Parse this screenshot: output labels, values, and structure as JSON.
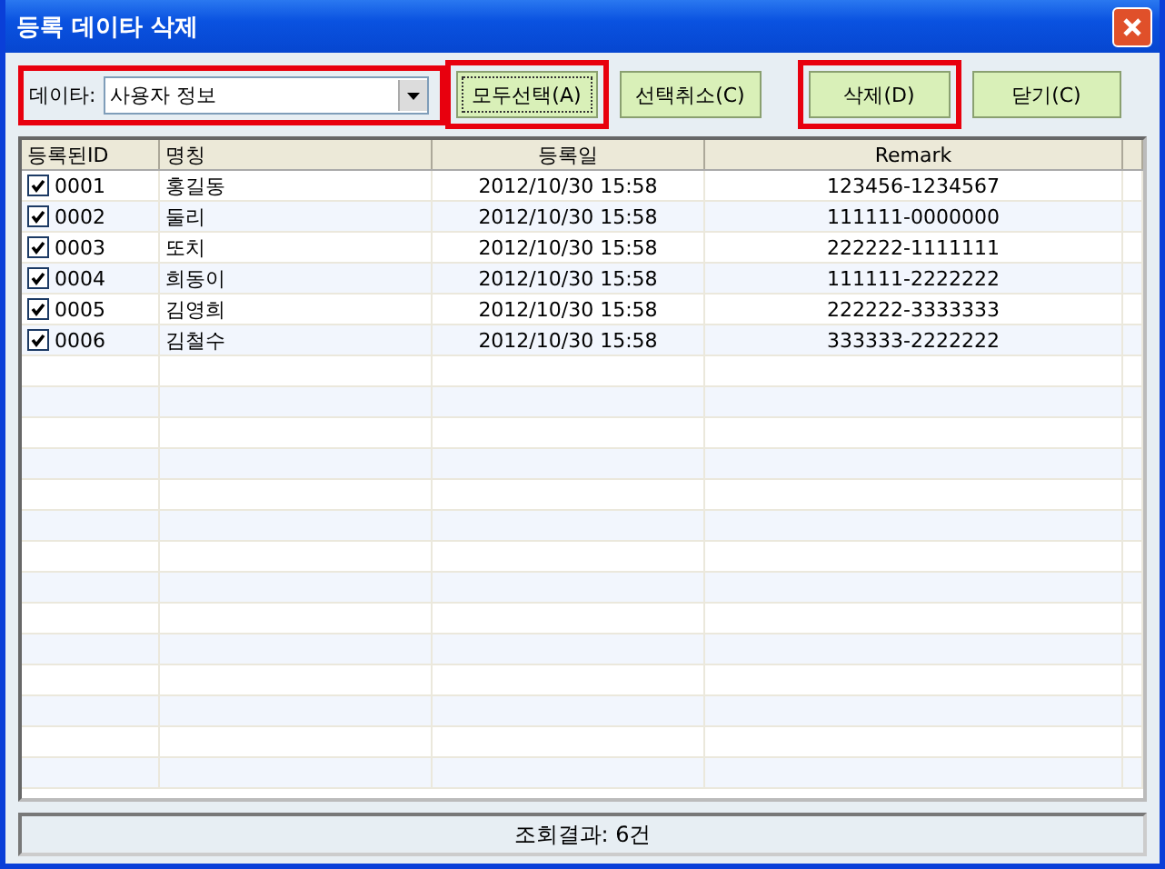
{
  "window": {
    "title": "등록 데이타 삭제"
  },
  "toolbar": {
    "data_label": "데이타:",
    "data_select": {
      "value": "사용자 정보",
      "highlighted": true
    },
    "buttons": [
      {
        "label": "모두선택(A)",
        "highlighted": true,
        "focused": true
      },
      {
        "label": "선택취소(C)",
        "highlighted": false,
        "focused": false
      },
      {
        "label": "삭제(D)",
        "highlighted": true,
        "focused": false
      },
      {
        "label": "닫기(C)",
        "highlighted": false,
        "focused": false
      }
    ]
  },
  "table": {
    "columns": [
      "등록된ID",
      "명칭",
      "등록일",
      "Remark"
    ],
    "rows": [
      {
        "checked": true,
        "id": "0001",
        "name": "홍길동",
        "date": "2012/10/30 15:58",
        "remark": "123456-1234567"
      },
      {
        "checked": true,
        "id": "0002",
        "name": "둘리",
        "date": "2012/10/30 15:58",
        "remark": "111111-0000000"
      },
      {
        "checked": true,
        "id": "0003",
        "name": "또치",
        "date": "2012/10/30 15:58",
        "remark": "222222-1111111"
      },
      {
        "checked": true,
        "id": "0004",
        "name": "희동이",
        "date": "2012/10/30 15:58",
        "remark": "111111-2222222"
      },
      {
        "checked": true,
        "id": "0005",
        "name": "김영희",
        "date": "2012/10/30 15:58",
        "remark": "222222-3333333"
      },
      {
        "checked": true,
        "id": "0006",
        "name": "김철수",
        "date": "2012/10/30 15:58",
        "remark": "333333-2222222"
      }
    ]
  },
  "status_bar": {
    "text": "조회결과: 6건"
  }
}
